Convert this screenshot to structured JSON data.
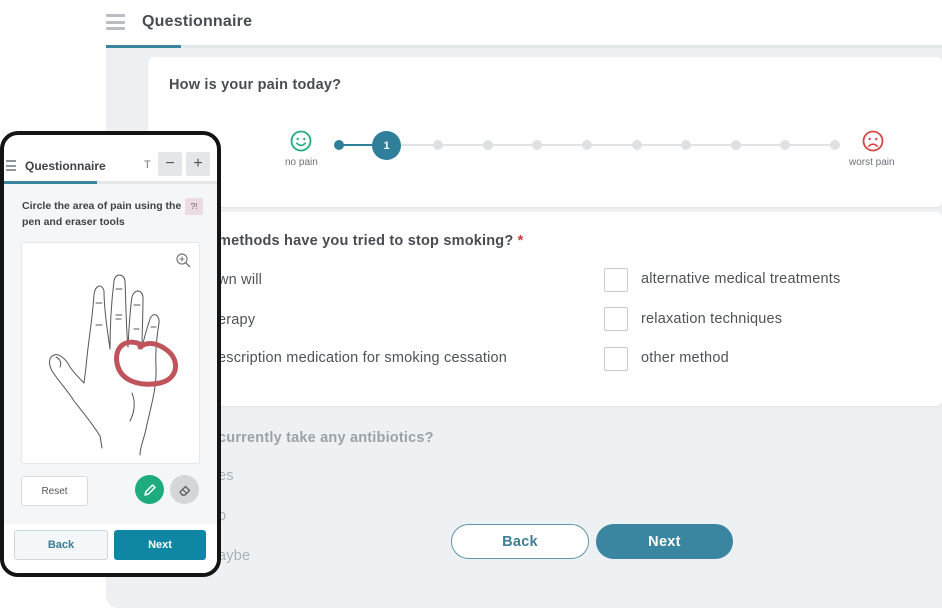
{
  "desktop": {
    "title": "Questionnaire",
    "progress_fraction": 0.09,
    "pain_question": {
      "text": "How is your pain today?",
      "selected_value": "1",
      "low_label": "no pain",
      "high_label": "worst pain",
      "steps": 11
    },
    "smoking_question": {
      "text": "methods have you tried to stop smoking?",
      "required_mark": "*",
      "left_options": [
        "wn will",
        "erapy",
        "escription medication for smoking cessation"
      ],
      "right_options": [
        "alternative medical treatments",
        "relaxation techniques",
        "other method"
      ]
    },
    "antibiotics_question": {
      "text": "currently take any antibiotics?",
      "options": [
        "es",
        "o",
        "aybe"
      ]
    },
    "back_label": "Back",
    "next_label": "Next",
    "colors": {
      "accent": "#3a86a0",
      "required": "#d03b3b",
      "happy_face": "#1eab7e",
      "sad_face": "#d64545"
    }
  },
  "mobile": {
    "title": "Questionnaire",
    "text_size_glyph": "T",
    "minus_glyph": "−",
    "plus_glyph": "+",
    "question": "Circle the area of pain using the pen and eraser tools",
    "help_glyph": "?!",
    "reset_label": "Reset",
    "back_label": "Back",
    "next_label": "Next",
    "icons": [
      "menu-icon",
      "zoom-in-icon",
      "pen-icon",
      "eraser-icon"
    ],
    "colors": {
      "pen": "#1eab7e",
      "circle": "#c0545c",
      "next": "#0f86a4"
    }
  }
}
